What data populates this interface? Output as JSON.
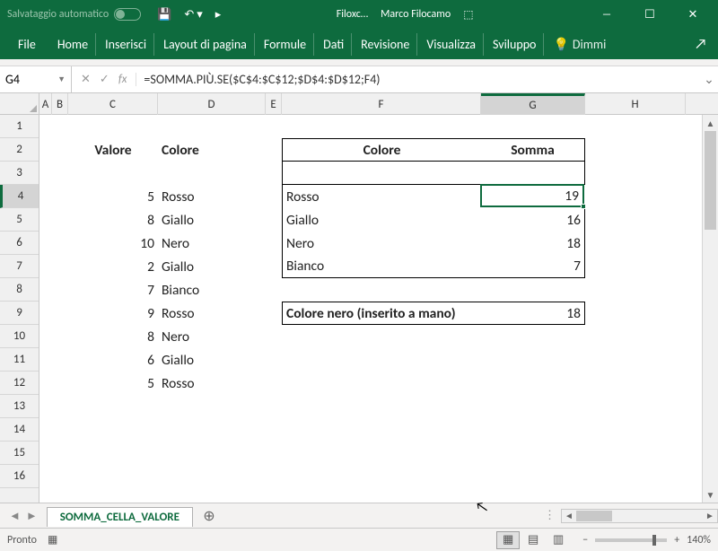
{
  "titlebar": {
    "autosave": "Salvataggio automatico",
    "doc": "Filoxc…",
    "user": "Marco Filocamo"
  },
  "ribbon": {
    "tabs": [
      "File",
      "Home",
      "Inserisci",
      "Layout di pagina",
      "Formule",
      "Dati",
      "Revisione",
      "Visualizza",
      "Sviluppo"
    ],
    "dimmi": "Dimmi"
  },
  "formula": {
    "name": "G4",
    "value": "=SOMMA.PIÙ.SE($C$4:$C$12;$D$4:$D$12;F4)"
  },
  "headers": {
    "cols": [
      "A",
      "B",
      "C",
      "D",
      "E",
      "F",
      "G",
      "H"
    ]
  },
  "sel": {
    "col": "G",
    "row": 4
  },
  "data": {
    "hdr": {
      "valore": "Valore",
      "colore": "Colore",
      "somma": "Somma"
    },
    "left": [
      {
        "v": 5,
        "c": "Rosso"
      },
      {
        "v": 8,
        "c": "Giallo"
      },
      {
        "v": 10,
        "c": "Nero"
      },
      {
        "v": 2,
        "c": "Giallo"
      },
      {
        "v": 7,
        "c": "Bianco"
      },
      {
        "v": 9,
        "c": "Rosso"
      },
      {
        "v": 8,
        "c": "Nero"
      },
      {
        "v": 6,
        "c": "Giallo"
      },
      {
        "v": 5,
        "c": "Rosso"
      }
    ],
    "right": [
      {
        "c": "Rosso",
        "s": 19
      },
      {
        "c": "Giallo",
        "s": 16
      },
      {
        "c": "Nero",
        "s": 18
      },
      {
        "c": "Bianco",
        "s": 7
      }
    ],
    "manual": {
      "label": "Colore nero (inserito a mano)",
      "val": 18
    }
  },
  "sheet": {
    "name": "SOMMA_CELLA_VALORE"
  },
  "status": {
    "ready": "Pronto",
    "zoom": "140%"
  }
}
